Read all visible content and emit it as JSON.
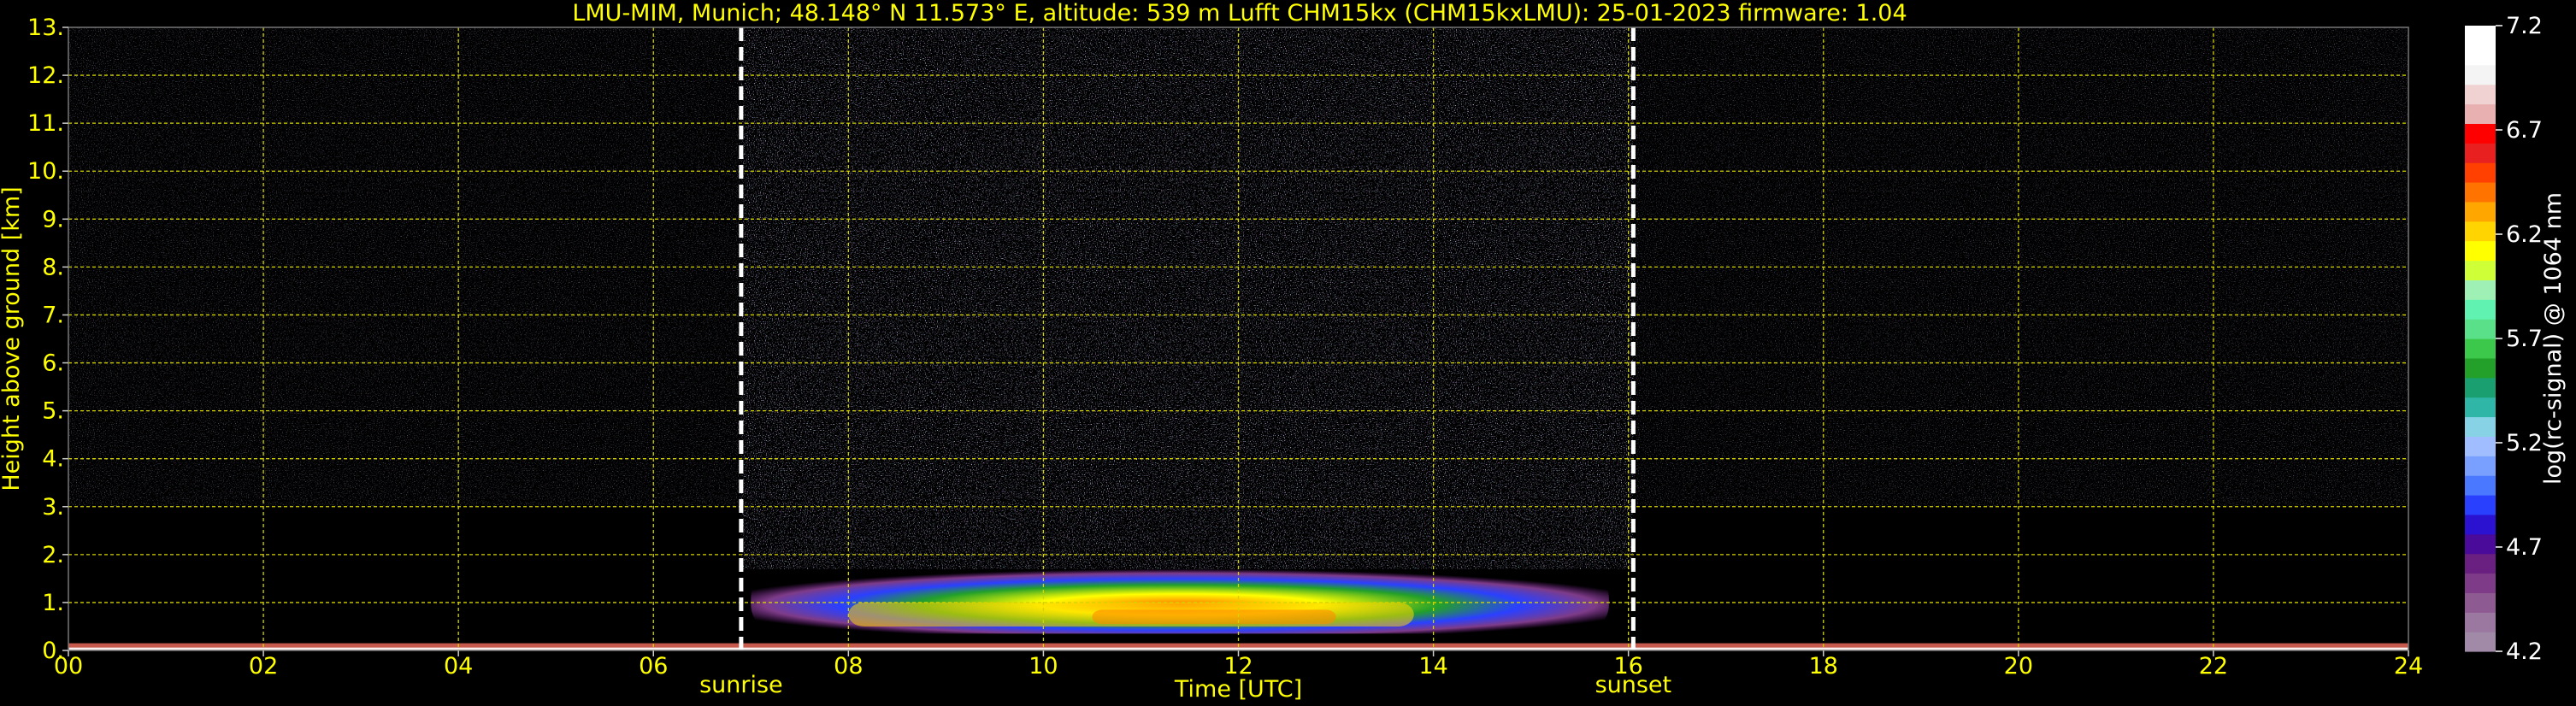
{
  "chart_data": {
    "type": "heatmap",
    "title": "LMU-MIM, Munich; 48.148° N 11.573° E, altitude: 539 m    Lufft CHM15kx (CHM15kxLMU): 25-01-2023    firmware: 1.04",
    "xlabel": "Time [UTC]",
    "ylabel": "Height above ground [km]",
    "xlim": [
      0,
      24
    ],
    "ylim": [
      0,
      13
    ],
    "x_ticks": [
      {
        "value": 0,
        "label": "00"
      },
      {
        "value": 2,
        "label": "02"
      },
      {
        "value": 4,
        "label": "04"
      },
      {
        "value": 6,
        "label": "06"
      },
      {
        "value": 8,
        "label": "08"
      },
      {
        "value": 10,
        "label": "10"
      },
      {
        "value": 12,
        "label": "12"
      },
      {
        "value": 14,
        "label": "14"
      },
      {
        "value": 16,
        "label": "16"
      },
      {
        "value": 18,
        "label": "18"
      },
      {
        "value": 20,
        "label": "20"
      },
      {
        "value": 22,
        "label": "22"
      },
      {
        "value": 24,
        "label": "24"
      }
    ],
    "y_ticks": [
      {
        "value": 0,
        "label": "0."
      },
      {
        "value": 1,
        "label": "1."
      },
      {
        "value": 2,
        "label": "2."
      },
      {
        "value": 3,
        "label": "3."
      },
      {
        "value": 4,
        "label": "4."
      },
      {
        "value": 5,
        "label": "5."
      },
      {
        "value": 6,
        "label": "6."
      },
      {
        "value": 7,
        "label": "7."
      },
      {
        "value": 8,
        "label": "8."
      },
      {
        "value": 9,
        "label": "9."
      },
      {
        "value": 10,
        "label": "10."
      },
      {
        "value": 11,
        "label": "11."
      },
      {
        "value": 12,
        "label": "12."
      },
      {
        "value": 13,
        "label": "13."
      }
    ],
    "grid": true,
    "grid_color": "#d4d400",
    "text_color": "#ffff00",
    "markers": [
      {
        "time": 6.9,
        "label": "sunrise"
      },
      {
        "time": 16.05,
        "label": "sunset"
      }
    ],
    "colorbar": {
      "label": "log(rc-signal) @ 1064 nm",
      "range": [
        4.2,
        7.2
      ],
      "ticks": [
        {
          "value": 4.2,
          "label": "4.2"
        },
        {
          "value": 4.7,
          "label": "4.7"
        },
        {
          "value": 5.2,
          "label": "5.2"
        },
        {
          "value": 5.7,
          "label": "5.7"
        },
        {
          "value": 6.2,
          "label": "6.2"
        },
        {
          "value": 6.7,
          "label": "6.7"
        },
        {
          "value": 7.2,
          "label": "7.2"
        }
      ],
      "colors": [
        "#a08aa8",
        "#9a78a0",
        "#8e5a92",
        "#7e3c88",
        "#6a2080",
        "#4a0a9a",
        "#2a12d0",
        "#2a40ff",
        "#4a78ff",
        "#7aa0ff",
        "#a0beff",
        "#88d2e6",
        "#30b6a6",
        "#1aa070",
        "#22a02a",
        "#3cc84a",
        "#5ae088",
        "#60f2b0",
        "#9ef0b4",
        "#cfff36",
        "#ffff00",
        "#ffd400",
        "#ffa600",
        "#ff7400",
        "#ff4000",
        "#e82020",
        "#ff0000",
        "#e8b0b0",
        "#f0d2d2",
        "#f4f4f4",
        "#ffffff",
        "#ffffff"
      ]
    },
    "signal_regions": [
      {
        "name": "boundary-layer-aerosol",
        "time_start": 7.0,
        "time_end": 15.8,
        "height_bottom": 0.35,
        "height_top": 1.7,
        "peak_log_signal": 6.2
      },
      {
        "name": "surface-layer",
        "time_start": 0,
        "time_end": 24,
        "height_bottom": 0.0,
        "height_top": 0.15,
        "peak_log_signal": 6.2
      },
      {
        "name": "daylight-noise",
        "time_start": 6.9,
        "time_end": 16.05,
        "height_bottom": 1.7,
        "height_top": 13,
        "peak_log_signal": 5.2
      }
    ]
  }
}
